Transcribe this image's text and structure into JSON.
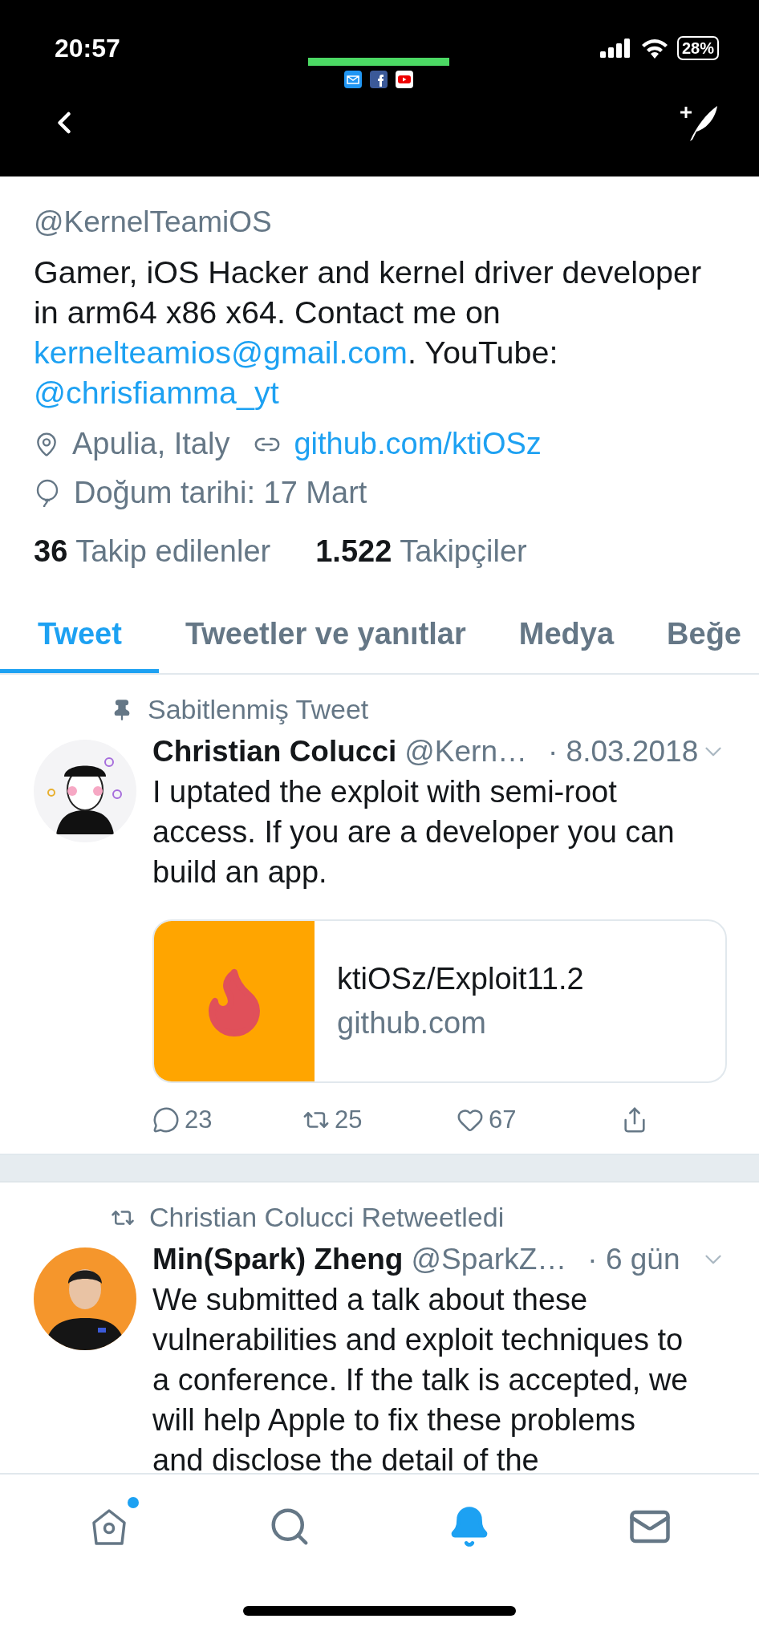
{
  "status_bar": {
    "time": "20:57",
    "battery": "28%"
  },
  "profile": {
    "handle": "@KernelTeamiOS",
    "bio": [
      {
        "kind": "plain",
        "text": "Gamer, iOS Hacker and kernel driver developer in arm64 x86 x64. Contact me on "
      },
      {
        "kind": "email",
        "text": "kernelteamios@gmail.com"
      },
      {
        "kind": "plain",
        "text": ". YouTube: "
      },
      {
        "kind": "mention",
        "text": "@chrisfiamma_yt"
      }
    ],
    "meta_rows": [
      [
        {
          "kind": "location",
          "text": "Apulia, Italy"
        },
        {
          "kind": "link",
          "text": "github.com/ktiOSz"
        }
      ],
      [
        {
          "kind": "birthday",
          "text": "Doğum tarihi: 17 Mart"
        }
      ]
    ],
    "stats": [
      {
        "count": "36",
        "label": "Takip edilenler"
      },
      {
        "count": "1.522",
        "label": "Takipçiler"
      }
    ]
  },
  "tabs": [
    {
      "label": "Tweet",
      "selected": true
    },
    {
      "label": "Tweetler ve yanıtlar",
      "selected": false
    },
    {
      "label": "Medya",
      "selected": false
    },
    {
      "label": "Beğe",
      "selected": false
    }
  ],
  "tweets": [
    {
      "context": {
        "kind": "pinned",
        "text": "Sabitlenmiş Tweet"
      },
      "name": "Christian Colucci",
      "handle": "@Kern…",
      "time": "· 8.03.2018",
      "text": "I uptated the exploit with semi-root access. If you are a developer you can build an app.",
      "card": {
        "title": "ktiOSz/Exploit11.2",
        "domain": "github.com"
      },
      "actions": [
        {
          "kind": "reply",
          "count": "23"
        },
        {
          "kind": "retweet",
          "count": "25"
        },
        {
          "kind": "like",
          "count": "67"
        },
        {
          "kind": "share"
        }
      ]
    },
    {
      "context": {
        "kind": "retweet",
        "text": "Christian Colucci Retweetledi"
      },
      "name": "Min(Spark) Zheng",
      "handle": "@SparkZ…",
      "time": "· 6 gün",
      "text": "We submitted a talk about these vulnerabilities and exploit techniques to a conference. If the talk is accepted, we will help Apple to fix these problems and disclose the detail of the"
    }
  ],
  "nav": [
    {
      "kind": "home",
      "selected": false,
      "badge": true
    },
    {
      "kind": "search",
      "selected": false,
      "badge": false
    },
    {
      "kind": "notifications",
      "selected": true,
      "badge": false
    },
    {
      "kind": "messages",
      "selected": false,
      "badge": false
    }
  ]
}
